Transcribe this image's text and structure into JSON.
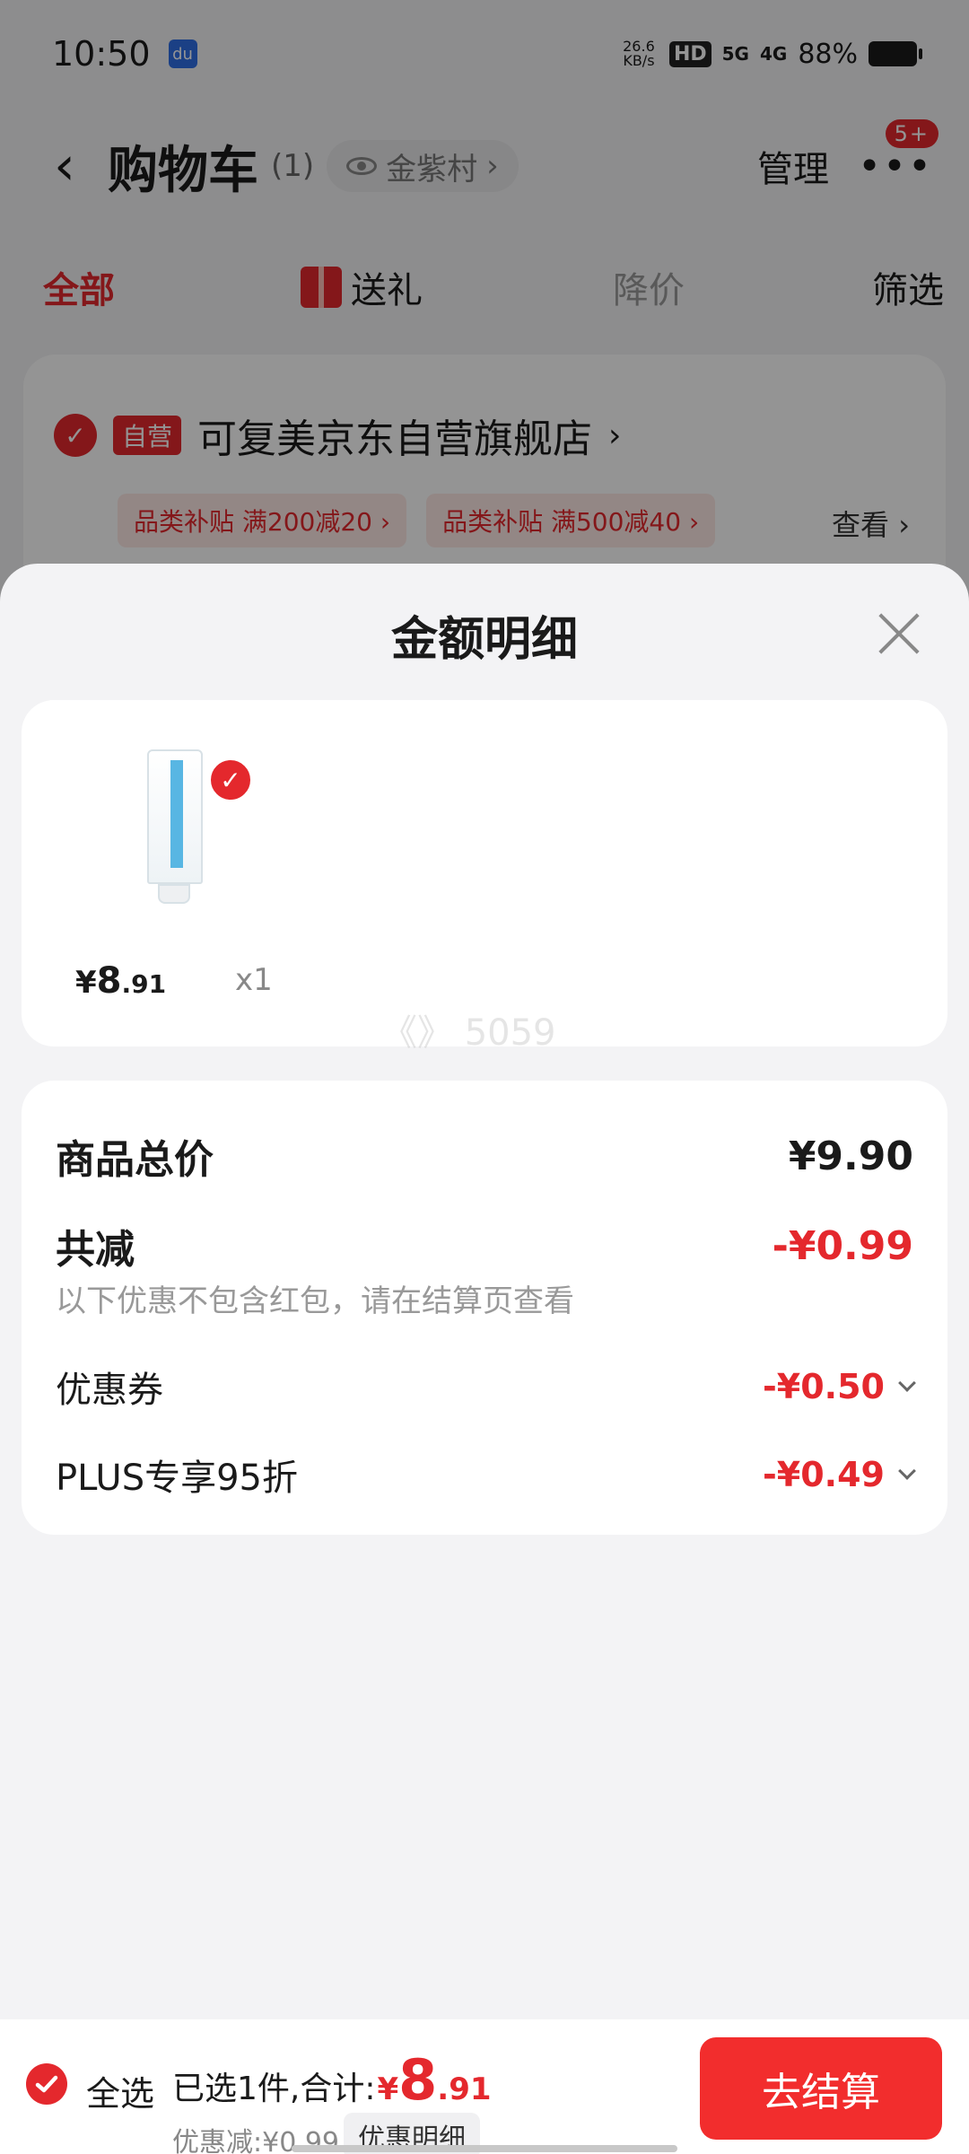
{
  "status_bar": {
    "time": "10:50",
    "net_speed_value": "26.6",
    "net_speed_unit": "KB/s",
    "hd_tag": "HD",
    "sim1_tag": "5G",
    "sim2_tag": "4G",
    "battery": "88%"
  },
  "header": {
    "title": "购物车",
    "count": "(1)",
    "location": "金紫村",
    "manage": "管理",
    "more_badge": "5+"
  },
  "tabs": {
    "all": "全部",
    "gift": "送礼",
    "price_drop": "降价",
    "filter": "筛选"
  },
  "store": {
    "self_tag": "自营",
    "name": "可复美京东自营旗舰店",
    "coupons": [
      "品类补贴 满200减20 ›",
      "品类补贴 满500减40 ›"
    ],
    "view_link": "查看 ›"
  },
  "sheet": {
    "title": "金额明细",
    "product": {
      "price_yen": "¥",
      "price_int": "8",
      "price_dec": ".91",
      "qty": "x1"
    },
    "watermark": "《》 5059",
    "summary": {
      "total_label": "商品总价",
      "total_value": "¥9.90",
      "reduce_label": "共减",
      "reduce_value": "-¥0.99",
      "reduce_note": "以下优惠不包含红包，请在结算页查看",
      "coupon_label": "优惠券",
      "coupon_value": "-¥0.50",
      "plus_label": "PLUS专享95折",
      "plus_value": "-¥0.49"
    }
  },
  "checkout": {
    "select_all": "全选",
    "selected_prefix": "已选1件,合计:",
    "total_yen": "¥",
    "total_int": "8",
    "total_dec": ".91",
    "discount_text": "优惠减:¥0.99",
    "detail_button": "优惠明细",
    "checkout_button": "去结算"
  },
  "colors": {
    "accent_red": "#e4282d",
    "button_red": "#f22d2d",
    "sheet_bg": "#f3f3f5"
  }
}
